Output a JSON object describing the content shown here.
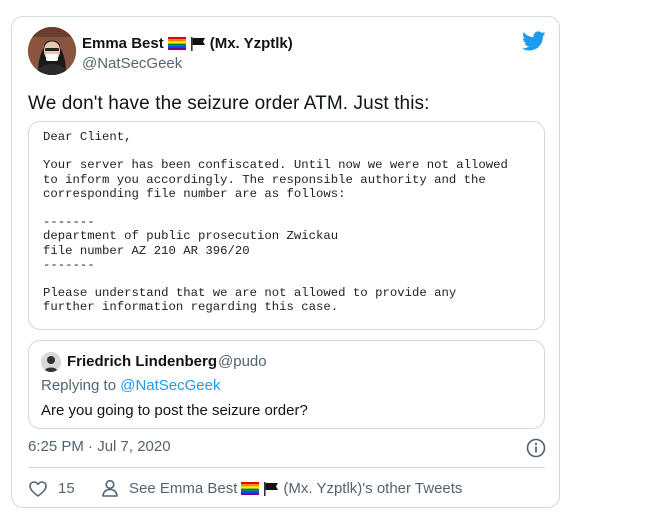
{
  "author": {
    "name": "Emma Best",
    "name_suffix": "(Mx. Yzptlk)",
    "handle": "@NatSecGeek"
  },
  "tweet": {
    "text": "We don't have the seizure order ATM. Just this:",
    "timestamp": "6:25 PM · Jul 7, 2020"
  },
  "letter_image": {
    "text": "Dear Client,\n\nYour server has been confiscated. Until now we were not allowed\nto inform you accordingly. The responsible authority and the\ncorresponding file number are as follows:\n\n-------\ndepartment of public prosecution Zwickau\nfile number AZ 210 AR 396/20\n-------\n\nPlease understand that we are not allowed to provide any\nfurther information regarding this case."
  },
  "quoted_tweet": {
    "name": "Friedrich Lindenberg",
    "handle": "@pudo",
    "replying_prefix": "Replying to ",
    "replying_handle": "@NatSecGeek",
    "text": "Are you going to post the seizure order?"
  },
  "actions": {
    "like_count": "15",
    "other_tweets_prefix": "See Emma Best",
    "other_tweets_suffix": "(Mx. Yzptlk)'s other Tweets"
  },
  "colors": {
    "link": "#1d9bf0",
    "secondary_text": "#536471",
    "border": "#cfd9de",
    "twitter_blue": "#1d9bf0"
  },
  "icons": [
    "twitter-bird-icon",
    "rainbow-flag-icon",
    "black-flag-icon",
    "info-icon",
    "heart-icon",
    "person-icon"
  ]
}
